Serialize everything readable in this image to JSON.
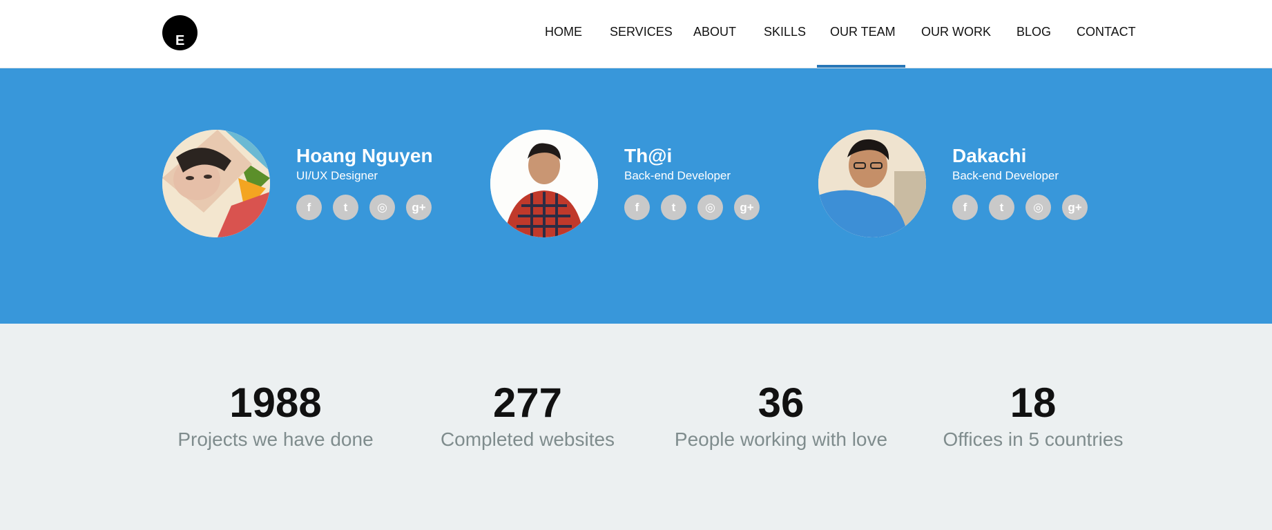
{
  "logo": {
    "letter": "E"
  },
  "nav": {
    "items": [
      "HOME",
      "SERVICES",
      "ABOUT",
      "SKILLS",
      "OUR TEAM",
      "OUR WORK",
      "BLOG",
      "CONTACT"
    ],
    "active": "OUR TEAM",
    "active_color": "#2877b8"
  },
  "team": {
    "background": "#3897da",
    "members": [
      {
        "name": "Hoang Nguyen",
        "role": "UI/UX Designer"
      },
      {
        "name": "Th@i",
        "role": "Back-end Developer"
      },
      {
        "name": "Dakachi",
        "role": "Back-end Developer"
      }
    ],
    "social_icons": [
      "facebook-icon",
      "twitter-icon",
      "dribbble-icon",
      "google-plus-icon"
    ],
    "social_glyphs": [
      "f",
      "t",
      "◎",
      "g+"
    ]
  },
  "stats": {
    "items": [
      {
        "number": "1988",
        "label": "Projects we have done"
      },
      {
        "number": "277",
        "label": "Completed websites"
      },
      {
        "number": "36",
        "label": "People working with love"
      },
      {
        "number": "18",
        "label": "Offices in 5 countries"
      }
    ]
  }
}
